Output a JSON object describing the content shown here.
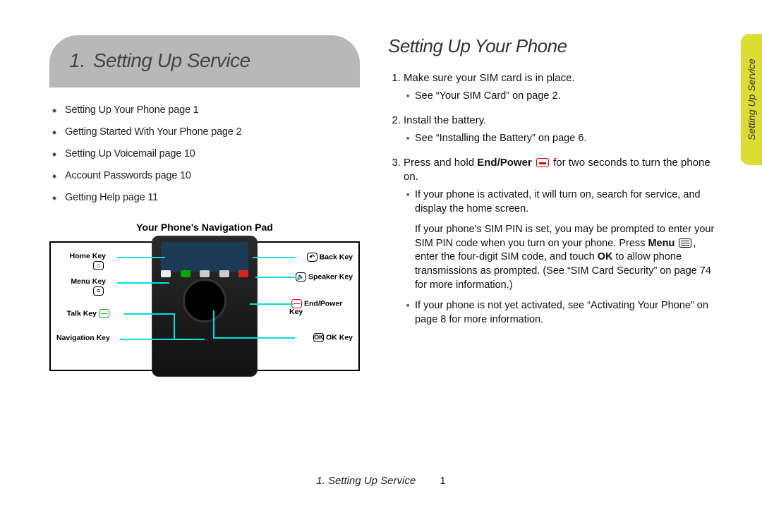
{
  "chapter": {
    "number": "1.",
    "title": "Setting Up Service"
  },
  "toc": [
    "Setting Up Your Phone page 1",
    "Getting Started With Your Phone page 2",
    "Setting Up Voicemail page 10",
    "Account Passwords page 10",
    "Getting Help page 11"
  ],
  "navpad": {
    "title": "Your Phone’s Navigation Pad",
    "left": {
      "home": "Home Key",
      "menu": "Menu Key",
      "talk": "Talk Key",
      "nav": "Navigation Key"
    },
    "right": {
      "back": "Back Key",
      "speaker": "Speaker Key",
      "endpower": "End/Power Key",
      "ok": "OK Key"
    }
  },
  "section": {
    "title": "Setting Up Your Phone",
    "steps": {
      "s1": "Make sure your SIM card is in place.",
      "s1a": "See “Your SIM Card” on page 2.",
      "s2": "Install the battery.",
      "s2a": "See “Installing the Battery” on page 6.",
      "s3_pre": "Press and hold ",
      "s3_bold": "End/Power",
      "s3_post": " for two seconds to turn the phone on.",
      "s3a": "If your phone is activated, it will turn on, search for service, and display the home screen.",
      "s3b_pre": "If your phone's SIM PIN is set, you may be prompted to enter your SIM PIN code when you turn on your phone. Press ",
      "s3b_bold1": "Menu",
      "s3b_mid": ", enter the four-digit SIM code, and touch ",
      "s3b_bold2": "OK",
      "s3b_post": " to allow phone transmissions as prompted. (See “SIM Card Security” on page 74 for more information.)",
      "s3c": "If your phone is not yet activated, see “Activating Your Phone” on page 8 for more information."
    }
  },
  "sidetab": "Setting Up Service",
  "footer": {
    "chapter": "1. Setting Up Service",
    "page": "1"
  }
}
